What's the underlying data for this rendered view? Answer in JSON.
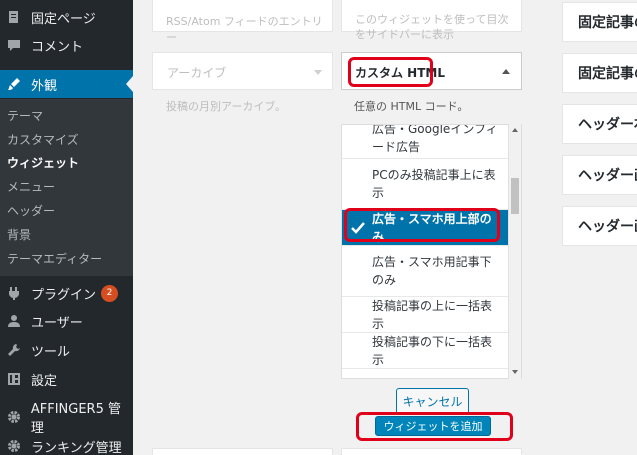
{
  "sidebar": {
    "menu": [
      {
        "label": "固定ページ",
        "icon": "page-icon"
      },
      {
        "label": "コメント",
        "icon": "comment-icon"
      },
      {
        "label": "外観",
        "icon": "appearance-icon"
      },
      {
        "label": "プラグイン",
        "icon": "plugin-icon",
        "badge": "2"
      },
      {
        "label": "ユーザー",
        "icon": "user-icon"
      },
      {
        "label": "ツール",
        "icon": "wrench-icon"
      },
      {
        "label": "設定",
        "icon": "settings-icon"
      },
      {
        "label": "AFFINGER5 管理",
        "icon": "gear-icon"
      },
      {
        "label": "ランキング管理",
        "icon": "gear-icon"
      }
    ],
    "submenu": [
      "テーマ",
      "カスタマイズ",
      "ウィジェット",
      "メニュー",
      "ヘッダー",
      "背景",
      "テーマエディター"
    ],
    "current_submenu": "ウィジェット"
  },
  "widgets": {
    "left_top_desc": "RSS/Atom フィードのエントリー",
    "archive_title": "アーカイブ",
    "archive_desc": "投稿の月別アーカイブ。",
    "toc_desc": "このウィジェットを使って目次をサイドバーに表示",
    "selected_widget_title": "カスタム HTML",
    "selected_widget_desc": "任意の HTML コード。"
  },
  "area_list": {
    "options": [
      "広告・Googleインフィード広告",
      "PCのみ投稿記事上に表示",
      "広告・スマホ用上部のみ",
      "広告・スマホ用記事下のみ",
      "投稿記事の上に一括表示",
      "投稿記事の下に一括表示"
    ],
    "selected": "広告・スマホ用上部のみ"
  },
  "buttons": {
    "cancel": "キャンセル",
    "add_widget": "ウィジェットを追加"
  },
  "right_areas": [
    "固定記事の",
    "固定記事の",
    "ヘッダー右",
    "ヘッダー画",
    "ヘッダー画"
  ],
  "colors": {
    "sidebar_bg": "#23282d",
    "accent": "#0073aa",
    "highlight": "#e0001a"
  }
}
